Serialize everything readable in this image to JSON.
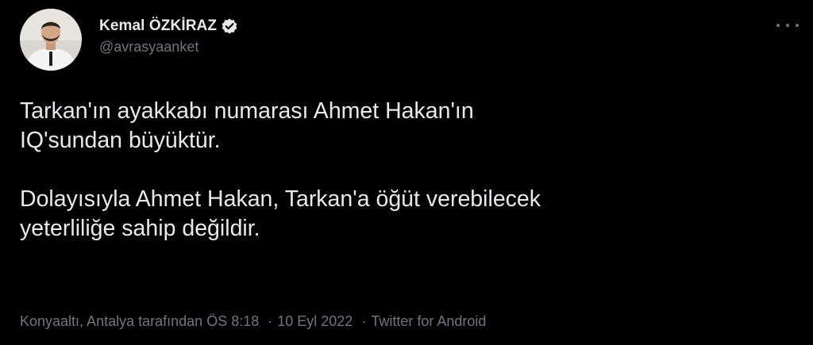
{
  "author": {
    "display_name": "Kemal ÖZKİRAZ",
    "handle": "@avrasyaanket",
    "verified": true,
    "avatar_icon": "profile-photo-man-in-suit"
  },
  "tweet": {
    "paragraphs": [
      {
        "line1": "Tarkan'ın ayakkabı numarası Ahmet Hakan'ın",
        "line2": "IQ'sundan büyüktür."
      },
      {
        "line1": "Dolayısıyla Ahmet Hakan, Tarkan'a öğüt verebilecek",
        "line2": "yeterliliğe sahip değildir."
      }
    ]
  },
  "meta": {
    "location": "Konyaaltı, Antalya tarafından",
    "time": "ÖS 8:18",
    "date": "10 Eyl 2022",
    "source": "Twitter for Android",
    "separator": "·"
  },
  "colors": {
    "background": "#000000",
    "primary_text": "#e7e9ea",
    "secondary_text": "#71767b"
  },
  "icons": {
    "more": "more-horizontal-icon",
    "verified": "verified-badge-icon"
  }
}
